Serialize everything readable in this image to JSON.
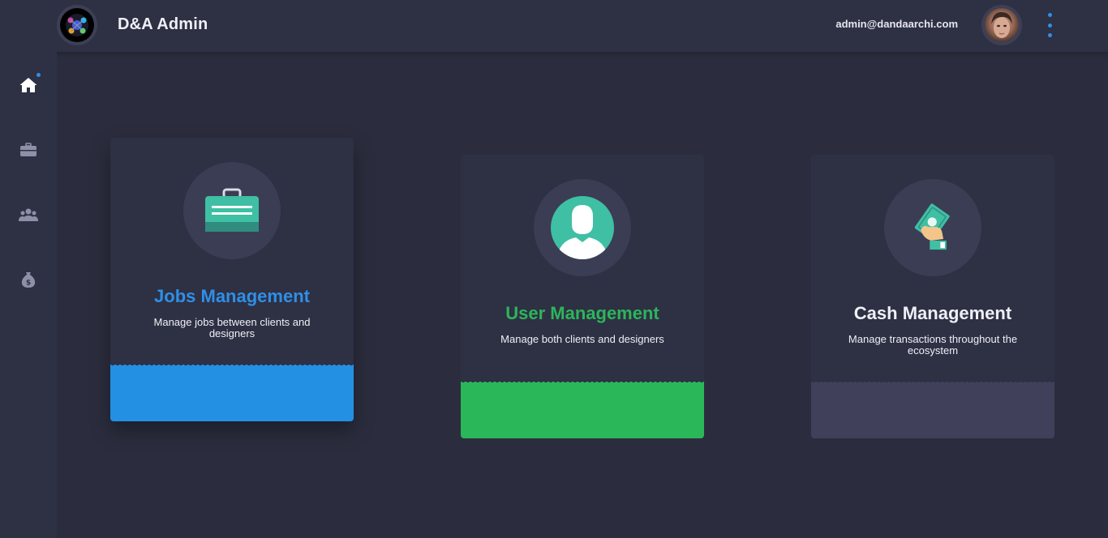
{
  "header": {
    "app_title": "D&A Admin",
    "user_email": "admin@dandaarchi.com"
  },
  "sidebar": {
    "items": [
      {
        "name": "home",
        "icon": "home-icon",
        "active": true
      },
      {
        "name": "jobs",
        "icon": "briefcase-icon",
        "active": false
      },
      {
        "name": "users",
        "icon": "users-icon",
        "active": false
      },
      {
        "name": "cash",
        "icon": "money-bag-icon",
        "active": false
      }
    ]
  },
  "cards": [
    {
      "title": "Jobs Management",
      "description": "Manage jobs between clients and designers",
      "icon": "briefcase-icon",
      "accent": "#2f8fe6",
      "footer_color": "#2390e3"
    },
    {
      "title": "User Management",
      "description": "Manage both clients and designers",
      "icon": "user-icon",
      "accent": "#2cb55a",
      "footer_color": "#2ab75a"
    },
    {
      "title": "Cash Management",
      "description": "Manage transactions throughout the ecosystem",
      "icon": "cash-hand-icon",
      "accent": "#eef0f6",
      "footer_color": "#40405a"
    }
  ],
  "colors": {
    "background": "#2b2d3e",
    "panel": "#2e3044",
    "accent_blue": "#2f8fe6",
    "icon_teal": "#3fbfa4"
  }
}
